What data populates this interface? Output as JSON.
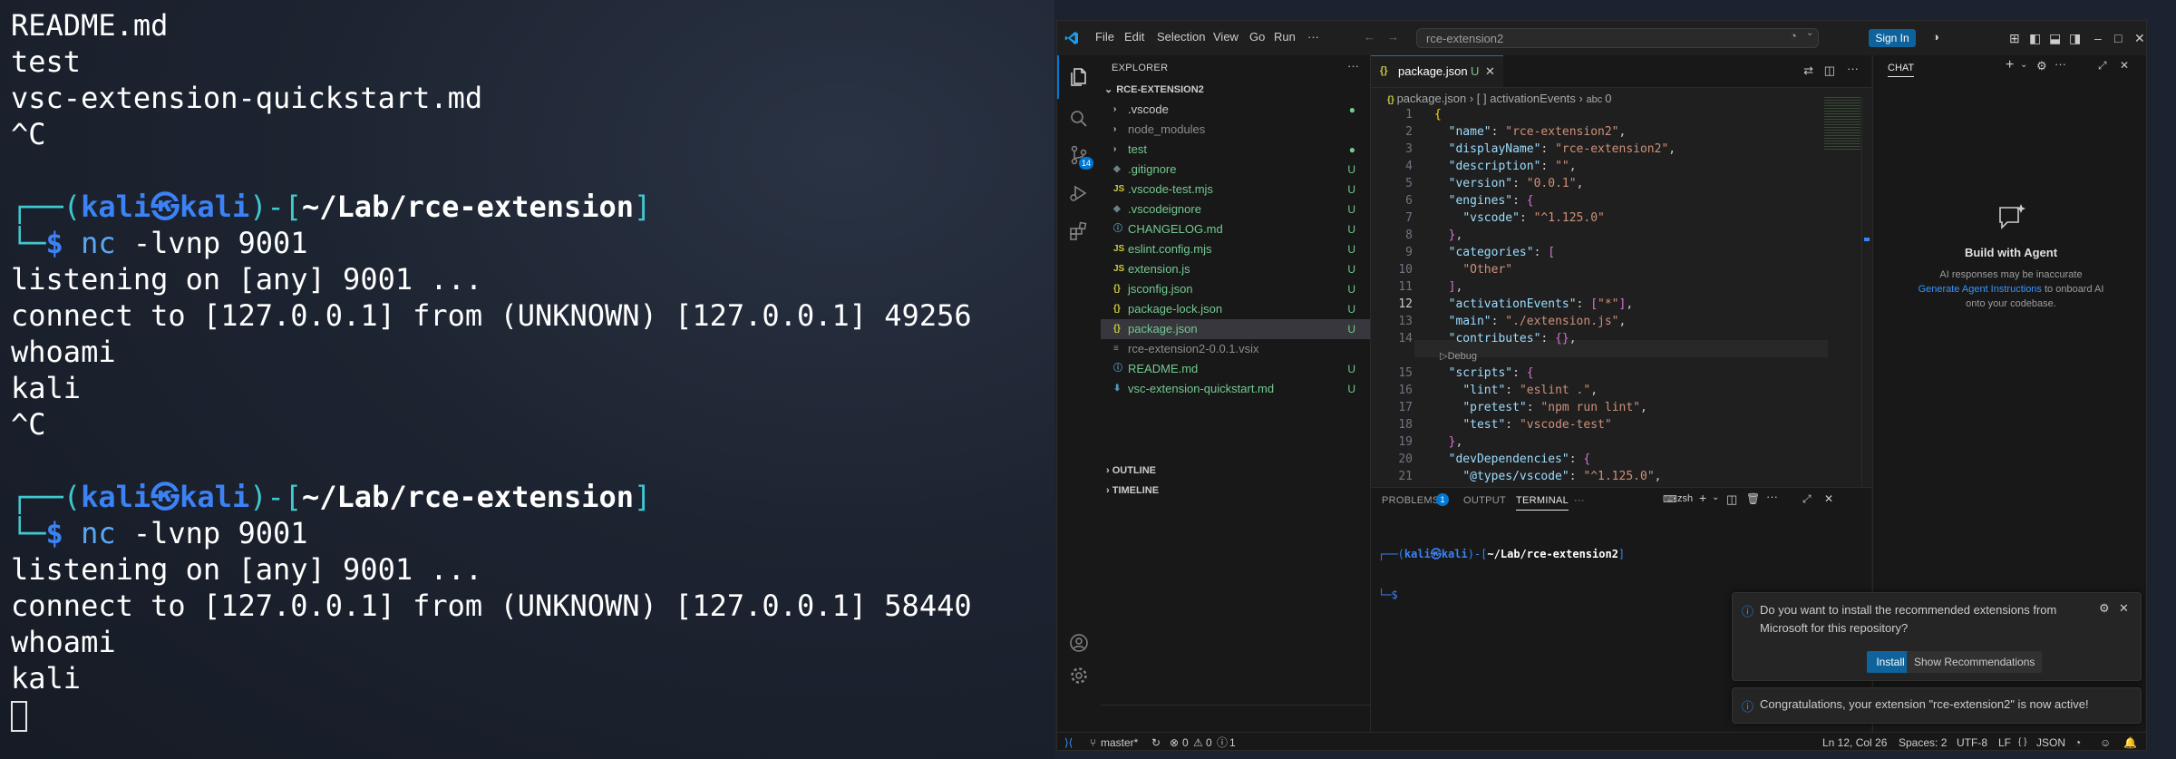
{
  "kali_terminal": {
    "lines": [
      {
        "kind": "text",
        "text": "README.md"
      },
      {
        "kind": "text",
        "text": "test"
      },
      {
        "kind": "text",
        "text": "vsc-extension-quickstart.md"
      },
      {
        "kind": "text",
        "text": "^C"
      },
      {
        "kind": "blank",
        "text": ""
      },
      {
        "kind": "prompt1",
        "pre": "┌──(",
        "user": "kali",
        "at": "㉿",
        "host": "kali",
        "mid": ")-[",
        "path": "~/Lab/rce-extension",
        "post": "]"
      },
      {
        "kind": "prompt2",
        "pre": "└─",
        "dollar": "$",
        "cmd": "nc",
        "args": " -lvnp 9001"
      },
      {
        "kind": "text",
        "text": "listening on [any] 9001 ..."
      },
      {
        "kind": "text",
        "text": "connect to [127.0.0.1] from (UNKNOWN) [127.0.0.1] 49256"
      },
      {
        "kind": "text",
        "text": "whoami"
      },
      {
        "kind": "text",
        "text": "kali"
      },
      {
        "kind": "text",
        "text": "^C"
      },
      {
        "kind": "blank",
        "text": ""
      },
      {
        "kind": "prompt1",
        "pre": "┌──(",
        "user": "kali",
        "at": "㉿",
        "host": "kali",
        "mid": ")-[",
        "path": "~/Lab/rce-extension",
        "post": "]"
      },
      {
        "kind": "prompt2",
        "pre": "└─",
        "dollar": "$",
        "cmd": "nc",
        "args": " -lvnp 9001"
      },
      {
        "kind": "text",
        "text": "listening on [any] 9001 ..."
      },
      {
        "kind": "text",
        "text": "connect to [127.0.0.1] from (UNKNOWN) [127.0.0.1] 58440"
      },
      {
        "kind": "text",
        "text": "whoami"
      },
      {
        "kind": "text",
        "text": "kali"
      },
      {
        "kind": "cursor",
        "text": ""
      }
    ]
  },
  "vscode": {
    "menu": [
      "File",
      "Edit",
      "Selection",
      "View",
      "Go",
      "Run",
      "···"
    ],
    "command_center": "rce-extension2",
    "sign_in": "Sign In",
    "explorer": {
      "title": "EXPLORER",
      "root": "RCE-EXTENSION2",
      "items": [
        {
          "icon": "›",
          "icon_color": "#cccccc",
          "name": ".vscode",
          "color": "#cccccc",
          "status": "●",
          "status_color": "#73c991"
        },
        {
          "icon": "›",
          "icon_color": "#cccccc",
          "name": "node_modules",
          "color": "#8c8c8c",
          "status": "",
          "status_color": "#73c991"
        },
        {
          "icon": "›",
          "icon_color": "#cccccc",
          "name": "test",
          "color": "#73c991",
          "status": "●",
          "status_color": "#73c991"
        },
        {
          "icon": "◆",
          "icon_color": "#6d8086",
          "name": ".gitignore",
          "color": "#73c991",
          "status": "U",
          "status_color": "#73c991"
        },
        {
          "icon": "JS",
          "icon_color": "#cbcb41",
          "name": ".vscode-test.mjs",
          "color": "#73c991",
          "status": "U",
          "status_color": "#73c991"
        },
        {
          "icon": "◆",
          "icon_color": "#6d8086",
          "name": ".vscodeignore",
          "color": "#73c991",
          "status": "U",
          "status_color": "#73c991"
        },
        {
          "icon": "ⓘ",
          "icon_color": "#519aba",
          "name": "CHANGELOG.md",
          "color": "#73c991",
          "status": "U",
          "status_color": "#73c991"
        },
        {
          "icon": "JS",
          "icon_color": "#cbcb41",
          "name": "eslint.config.mjs",
          "color": "#73c991",
          "status": "U",
          "status_color": "#73c991"
        },
        {
          "icon": "JS",
          "icon_color": "#cbcb41",
          "name": "extension.js",
          "color": "#73c991",
          "status": "U",
          "status_color": "#73c991"
        },
        {
          "icon": "{}",
          "icon_color": "#cbcb41",
          "name": "jsconfig.json",
          "color": "#73c991",
          "status": "U",
          "status_color": "#73c991"
        },
        {
          "icon": "{}",
          "icon_color": "#cbcb41",
          "name": "package-lock.json",
          "color": "#73c991",
          "status": "U",
          "status_color": "#73c991"
        },
        {
          "icon": "{}",
          "icon_color": "#cbcb41",
          "name": "package.json",
          "color": "#73c991",
          "status": "U",
          "status_color": "#73c991",
          "selected": true
        },
        {
          "icon": "≡",
          "icon_color": "#8c8c8c",
          "name": "rce-extension2-0.0.1.vsix",
          "color": "#8c8c8c",
          "status": "",
          "status_color": "#73c991"
        },
        {
          "icon": "ⓘ",
          "icon_color": "#519aba",
          "name": "README.md",
          "color": "#73c991",
          "status": "U",
          "status_color": "#73c991"
        },
        {
          "icon": "⬇",
          "icon_color": "#519aba",
          "name": "vsc-extension-quickstart.md",
          "color": "#73c991",
          "status": "U",
          "status_color": "#73c991"
        }
      ],
      "outline": "OUTLINE",
      "timeline": "TIMELINE"
    },
    "tab": {
      "label": "package.json",
      "status": "U"
    },
    "breadcrumbs": {
      "file": "package.json",
      "sep": "›",
      "key": "[ ] activationEvents",
      "idx": "0"
    },
    "code": [
      {
        "n": "1",
        "tokens": [
          [
            "p",
            "{"
          ]
        ]
      },
      {
        "n": "2",
        "tokens": [
          [
            "w",
            "  "
          ],
          [
            "k",
            "\"name\""
          ],
          [
            "w",
            ": "
          ],
          [
            "s",
            "\"rce-extension2\""
          ],
          [
            "w",
            ","
          ]
        ]
      },
      {
        "n": "3",
        "tokens": [
          [
            "w",
            "  "
          ],
          [
            "k",
            "\"displayName\""
          ],
          [
            "w",
            ": "
          ],
          [
            "s",
            "\"rce-extension2\""
          ],
          [
            "w",
            ","
          ]
        ]
      },
      {
        "n": "4",
        "tokens": [
          [
            "w",
            "  "
          ],
          [
            "k",
            "\"description\""
          ],
          [
            "w",
            ": "
          ],
          [
            "s",
            "\"\""
          ],
          [
            "w",
            ","
          ]
        ]
      },
      {
        "n": "5",
        "tokens": [
          [
            "w",
            "  "
          ],
          [
            "k",
            "\"version\""
          ],
          [
            "w",
            ": "
          ],
          [
            "s",
            "\"0.0.1\""
          ],
          [
            "w",
            ","
          ]
        ]
      },
      {
        "n": "6",
        "tokens": [
          [
            "w",
            "  "
          ],
          [
            "k",
            "\"engines\""
          ],
          [
            "w",
            ": "
          ],
          [
            "pp",
            "{"
          ]
        ]
      },
      {
        "n": "7",
        "tokens": [
          [
            "w",
            "    "
          ],
          [
            "k",
            "\"vscode\""
          ],
          [
            "w",
            ": "
          ],
          [
            "s",
            "\"^1.125.0\""
          ]
        ]
      },
      {
        "n": "8",
        "tokens": [
          [
            "w",
            "  "
          ],
          [
            "pp",
            "}"
          ],
          [
            "w",
            ","
          ]
        ]
      },
      {
        "n": "9",
        "tokens": [
          [
            "w",
            "  "
          ],
          [
            "k",
            "\"categories\""
          ],
          [
            "w",
            ": "
          ],
          [
            "pp",
            "["
          ]
        ]
      },
      {
        "n": "10",
        "tokens": [
          [
            "w",
            "    "
          ],
          [
            "s",
            "\"Other\""
          ]
        ]
      },
      {
        "n": "11",
        "tokens": [
          [
            "w",
            "  "
          ],
          [
            "pp",
            "]"
          ],
          [
            "w",
            ","
          ]
        ]
      },
      {
        "n": "12",
        "tokens": [
          [
            "w",
            "  "
          ],
          [
            "k",
            "\"activationEvents\""
          ],
          [
            "w",
            ": "
          ],
          [
            "pp",
            "["
          ],
          [
            "s",
            "\"*\""
          ],
          [
            "pp",
            "]"
          ],
          [
            "w",
            ","
          ]
        ]
      },
      {
        "n": "13",
        "tokens": [
          [
            "w",
            "  "
          ],
          [
            "k",
            "\"main\""
          ],
          [
            "w",
            ": "
          ],
          [
            "s",
            "\"./extension.js\""
          ],
          [
            "w",
            ","
          ]
        ]
      },
      {
        "n": "14",
        "tokens": [
          [
            "w",
            "  "
          ],
          [
            "k",
            "\"contributes\""
          ],
          [
            "w",
            ": "
          ],
          [
            "pp",
            "{}"
          ],
          [
            "w",
            ","
          ]
        ]
      },
      {
        "n": "",
        "tokens": [
          [
            "w",
            "  ▷Debug"
          ]
        ]
      },
      {
        "n": "15",
        "tokens": [
          [
            "w",
            "  "
          ],
          [
            "k",
            "\"scripts\""
          ],
          [
            "w",
            ": "
          ],
          [
            "pp",
            "{"
          ]
        ]
      },
      {
        "n": "16",
        "tokens": [
          [
            "w",
            "    "
          ],
          [
            "k",
            "\"lint\""
          ],
          [
            "w",
            ": "
          ],
          [
            "s",
            "\"eslint .\""
          ],
          [
            "w",
            ","
          ]
        ]
      },
      {
        "n": "17",
        "tokens": [
          [
            "w",
            "    "
          ],
          [
            "k",
            "\"pretest\""
          ],
          [
            "w",
            ": "
          ],
          [
            "s",
            "\"npm run lint\""
          ],
          [
            "w",
            ","
          ]
        ]
      },
      {
        "n": "18",
        "tokens": [
          [
            "w",
            "    "
          ],
          [
            "k",
            "\"test\""
          ],
          [
            "w",
            ": "
          ],
          [
            "s",
            "\"vscode-test\""
          ]
        ]
      },
      {
        "n": "19",
        "tokens": [
          [
            "w",
            "  "
          ],
          [
            "pp",
            "}"
          ],
          [
            "w",
            ","
          ]
        ]
      },
      {
        "n": "20",
        "tokens": [
          [
            "w",
            "  "
          ],
          [
            "k",
            "\"devDependencies\""
          ],
          [
            "w",
            ": "
          ],
          [
            "pp",
            "{"
          ]
        ]
      },
      {
        "n": "21",
        "tokens": [
          [
            "w",
            "    "
          ],
          [
            "k",
            "\"@types/vscode\""
          ],
          [
            "w",
            ": "
          ],
          [
            "s",
            "\"^1.125.0\""
          ],
          [
            "w",
            ","
          ]
        ]
      }
    ],
    "panel": {
      "problems": "PROBLEMS",
      "problems_count": "1",
      "output": "OUTPUT",
      "terminal": "TERMINAL",
      "more": "···",
      "shell": "zsh",
      "prompt": {
        "pre": "┌──(",
        "user": "kali",
        "at": "㉿",
        "host": "kali",
        "mid": ")-[",
        "path": "~/Lab/rce-extension2",
        "post": "]"
      },
      "prompt2": "└─$"
    },
    "chat": {
      "title": "CHAT",
      "heading": "Build with Agent",
      "line1": "AI responses may be inaccurate",
      "link": "Generate Agent Instructions",
      "line2a": " to onboard AI",
      "line3": "onto your codebase."
    },
    "notifications": {
      "recommend_text": "Do you want to install the recommended extensions from Microsoft for this repository?",
      "install": "Install",
      "show": "Show Recommendations",
      "congrats": "Congratulations, your extension \"rce-extension2\" is now active!"
    },
    "status": {
      "branch": "master*",
      "errors": "0",
      "warnings": "0",
      "info": "1",
      "position": "Ln 12, Col 26",
      "spaces": "Spaces: 2",
      "encoding": "UTF-8",
      "eol": "LF",
      "language": "JSON",
      "lang_icon": "{ }"
    },
    "colors": {
      "accent": "#0078d4",
      "git_added": "#73c991",
      "button": "#0e639c"
    }
  }
}
